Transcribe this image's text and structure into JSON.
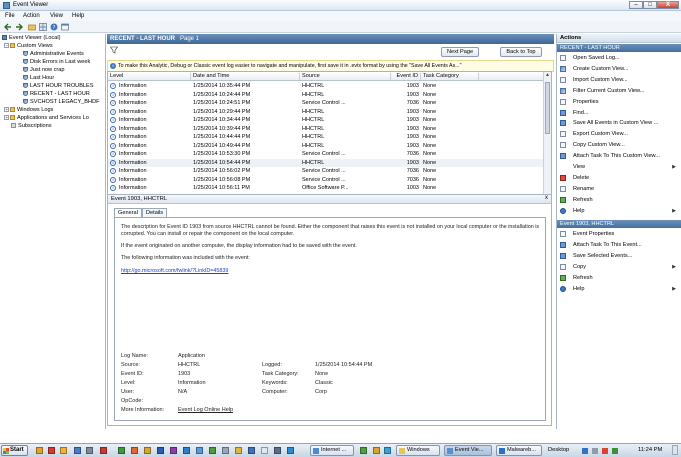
{
  "window": {
    "title": "Event Viewer",
    "min": "–",
    "max": "□",
    "close": "X"
  },
  "menu": [
    "File",
    "Action",
    "View",
    "Help"
  ],
  "toolbar_icons": [
    "back-arrow-icon",
    "forward-arrow-icon",
    "folder-icon",
    "grid-icon",
    "help-icon",
    "console-icon"
  ],
  "tree": {
    "root": "Event Viewer (Local)",
    "custom_views": "Custom Views",
    "items": [
      "Administrative Events",
      "Disk Errors in Last week",
      "Just now crap",
      "Last Hour",
      "LAST HOUR TROUBLES",
      "RECENT - LAST HOUR",
      "SVCHOST LEGACY_BHDF"
    ],
    "windows_logs": "Windows Logs",
    "apps_services": "Applications and Services Lo",
    "subscriptions": "Subscriptions"
  },
  "center": {
    "title": "RECENT - LAST HOUR",
    "count": "Page 1",
    "next_page": "Next Page",
    "back_to_top": "Back to Top",
    "info": "To make this Analytic, Debug or Classic event log easier to navigate and manipulate, first save it in .evtx format by using the \"Save All Events As...\"",
    "columns": [
      "Level",
      "Date and Time",
      "Source",
      "Event ID",
      "Task Category"
    ],
    "rows": [
      [
        "Information",
        "1/25/2014 10:35:44 PM",
        "HHCTRL",
        "1903",
        "None"
      ],
      [
        "Information",
        "1/25/2014 10:24:44 PM",
        "HHCTRL",
        "1903",
        "None"
      ],
      [
        "Information",
        "1/25/2014 10:24:51 PM",
        "Service Control ...",
        "7036",
        "None"
      ],
      [
        "Information",
        "1/25/2014 10:29:44 PM",
        "HHCTRL",
        "1903",
        "None"
      ],
      [
        "Information",
        "1/25/2014 10:34:44 PM",
        "HHCTRL",
        "1903",
        "None"
      ],
      [
        "Information",
        "1/25/2014 10:39:44 PM",
        "HHCTRL",
        "1903",
        "None"
      ],
      [
        "Information",
        "1/25/2014 10:44:44 PM",
        "HHCTRL",
        "1903",
        "None"
      ],
      [
        "Information",
        "1/25/2014 10:49:44 PM",
        "HHCTRL",
        "1903",
        "None"
      ],
      [
        "Information",
        "1/25/2014 10:53:30 PM",
        "Service Control ...",
        "7036",
        "None"
      ],
      [
        "Information",
        "1/25/2014 10:54:44 PM",
        "HHCTRL",
        "1903",
        "None"
      ],
      [
        "Information",
        "1/25/2014 10:56:02 PM",
        "Service Control ...",
        "7036",
        "None"
      ],
      [
        "Information",
        "1/25/2014 10:56:08 PM",
        "Service Control ...",
        "7036",
        "None"
      ],
      [
        "Information",
        "1/25/2014 10:56:11 PM",
        "Office Software P...",
        "1003",
        "None"
      ]
    ],
    "selected_row": 9
  },
  "detail": {
    "title": "Event 1903, HHCTRL",
    "close": "x",
    "tabs": [
      "General",
      "Details"
    ],
    "desc1": "The description for Event ID 1903 from source HHCTRL cannot be found. Either the component that raises this event is not installed on your local computer or the installation is corrupted. You can install or repair the component on the local computer.",
    "desc2": "If the event originated on another computer, the display information had to be saved with the event.",
    "desc3": "The following information was included with the event:",
    "link": "http://go.microsoft.com/fwlink/?LinkID=45839",
    "labels": {
      "log_name": "Log Name:",
      "source": "Source:",
      "event_id": "Event ID:",
      "level": "Level:",
      "user": "User:",
      "opcode": "OpCode:",
      "more_info": "More Information:",
      "logged": "Logged:",
      "task_category": "Task Category:",
      "keywords": "Keywords:",
      "computer": "Computer:"
    },
    "values": {
      "log_name": "Application",
      "source": "HHCTRL",
      "event_id": "1903",
      "level": "Information",
      "user": "N/A",
      "more_info_link": "Event Log Online Help",
      "logged": "1/25/2014 10:54:44 PM",
      "task_category": "None",
      "keywords": "Classic",
      "computer": "Corp"
    }
  },
  "actions": {
    "header": "Actions",
    "section1": "RECENT - LAST HOUR",
    "items1": [
      {
        "label": "Open Saved Log...",
        "icon": "open-log-icon"
      },
      {
        "label": "Create Custom View...",
        "icon": "filter-icon"
      },
      {
        "label": "Import Custom View...",
        "icon": "import-icon"
      },
      {
        "label": "Filter Current Custom View...",
        "icon": "filter-icon"
      },
      {
        "label": "Properties",
        "icon": "properties-icon"
      },
      {
        "label": "Find...",
        "icon": "find-icon"
      },
      {
        "label": "Save All Events in Custom View ...",
        "icon": "save-icon"
      },
      {
        "label": "Export Custom View...",
        "icon": "export-icon"
      },
      {
        "label": "Copy Custom View...",
        "icon": "copy-icon"
      },
      {
        "label": "Attach Task To This Custom View...",
        "icon": "task-icon"
      },
      {
        "label": "View",
        "icon": "none",
        "arrow": "▶"
      },
      {
        "label": "Delete",
        "icon": "delete-icon"
      },
      {
        "label": "Rename",
        "icon": "rename-icon"
      },
      {
        "label": "Refresh",
        "icon": "refresh-icon"
      },
      {
        "label": "Help",
        "icon": "help-icon",
        "arrow": "▶"
      }
    ],
    "section2": "Event 1903, HHCTRL",
    "items2": [
      {
        "label": "Event Properties",
        "icon": "properties-icon"
      },
      {
        "label": "Attach Task To This Event...",
        "icon": "task-icon"
      },
      {
        "label": "Save Selected Events...",
        "icon": "save-icon"
      },
      {
        "label": "Copy",
        "icon": "copy-icon",
        "arrow": "▶"
      },
      {
        "label": "Refresh",
        "icon": "refresh-icon"
      },
      {
        "label": "Help",
        "icon": "help-icon",
        "arrow": "▶"
      }
    ]
  },
  "taskbar": {
    "start": "Start",
    "tasks": [
      "Internet ...",
      "Windows",
      "Event Vie...",
      "Malwareb..."
    ],
    "tray_label": "Desktop",
    "clock": "11:24 PM"
  },
  "colors": {
    "header_blue": "#44709f",
    "link": "#1a44c4",
    "info_bg": "#fffde6"
  }
}
